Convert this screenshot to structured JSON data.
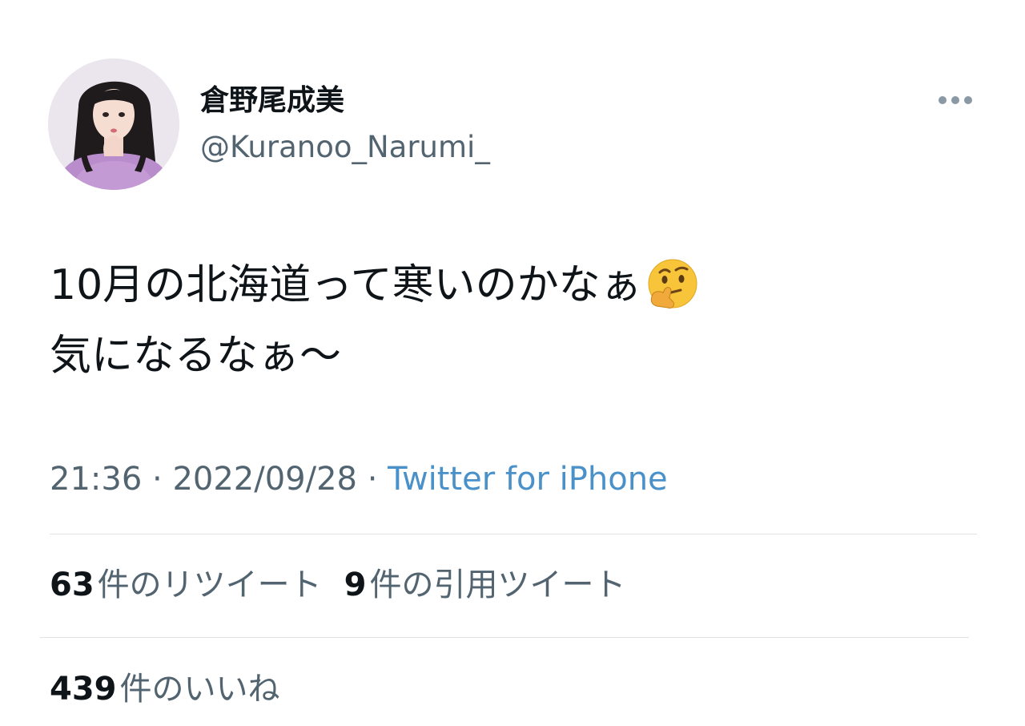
{
  "author": {
    "display_name": "倉野尾成美",
    "handle": "@Kuranoo_Narumi_",
    "avatar_icon": "profile-photo"
  },
  "more_icon": "ellipsis-icon",
  "tweet": {
    "line1": "10月の北海道って寒いのかなぁ",
    "line1_emoji": "thinking-face-emoji",
    "line2": "気になるなぁ〜"
  },
  "meta": {
    "time": "21:36",
    "separator1": " · ",
    "date": "2022/09/28",
    "separator2": " · ",
    "source": "Twitter for iPhone"
  },
  "stats": {
    "retweets_count": "63",
    "retweets_label": "件のリツイート",
    "quotes_count": "9",
    "quotes_label": "件の引用ツイート",
    "likes_count": "439",
    "likes_label": "件のいいね"
  },
  "colors": {
    "text_primary": "#0f1419",
    "text_secondary": "#536471",
    "link": "#4a91c9",
    "divider": "#dfe3e6"
  }
}
